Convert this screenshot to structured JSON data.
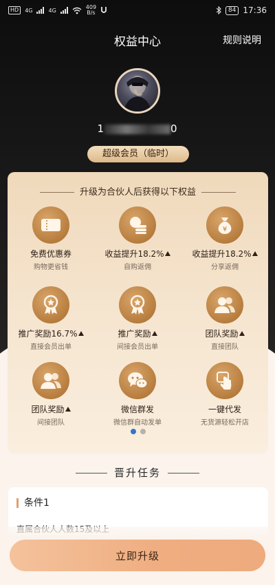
{
  "status_bar": {
    "left_chip": "HD",
    "sim1": "4G",
    "sim2": "4G",
    "speed": "409\nB/s",
    "battery": "84",
    "time": "17:36"
  },
  "header": {
    "title": "权益中心",
    "rules_link": "规则说明"
  },
  "profile": {
    "phone_prefix": "1",
    "phone_suffix": "0",
    "member_badge": "超级会员（临时）"
  },
  "benefits_card": {
    "heading": "升级为合伙人后获得以下权益",
    "items": [
      {
        "title": "免费优惠券",
        "sub": "购物更省钱",
        "icon": "ticket-icon",
        "arrow": false
      },
      {
        "title": "收益提升18.2%",
        "sub": "自购返佣",
        "icon": "coins-icon",
        "arrow": true
      },
      {
        "title": "收益提升18.2%",
        "sub": "分享返佣",
        "icon": "money-bag-icon",
        "arrow": true
      },
      {
        "title": "推广奖励16.7%",
        "sub": "直接会员出单",
        "icon": "medal-icon",
        "arrow": true
      },
      {
        "title": "推广奖励",
        "sub": "间接会员出单",
        "icon": "medal-icon",
        "arrow": true
      },
      {
        "title": "团队奖励",
        "sub": "直接团队",
        "icon": "team-icon",
        "arrow": true
      },
      {
        "title": "团队奖励",
        "sub": "间接团队",
        "icon": "team-icon",
        "arrow": true
      },
      {
        "title": "微信群发",
        "sub": "微信群自动发单",
        "icon": "wechat-icon",
        "arrow": false
      },
      {
        "title": "一键代发",
        "sub": "无货源轻松开店",
        "icon": "tap-icon",
        "arrow": false
      }
    ],
    "page_count": 2,
    "active_page": 1
  },
  "tasks": {
    "heading": "晋升任务",
    "condition_title": "条件1",
    "condition_desc": "直属合伙人人数15及以上"
  },
  "cta": {
    "label": "立即升级"
  },
  "colors": {
    "accent_gold": "#b77d3e",
    "button": "#efad80",
    "page_dot_active": "#2f78c5"
  }
}
